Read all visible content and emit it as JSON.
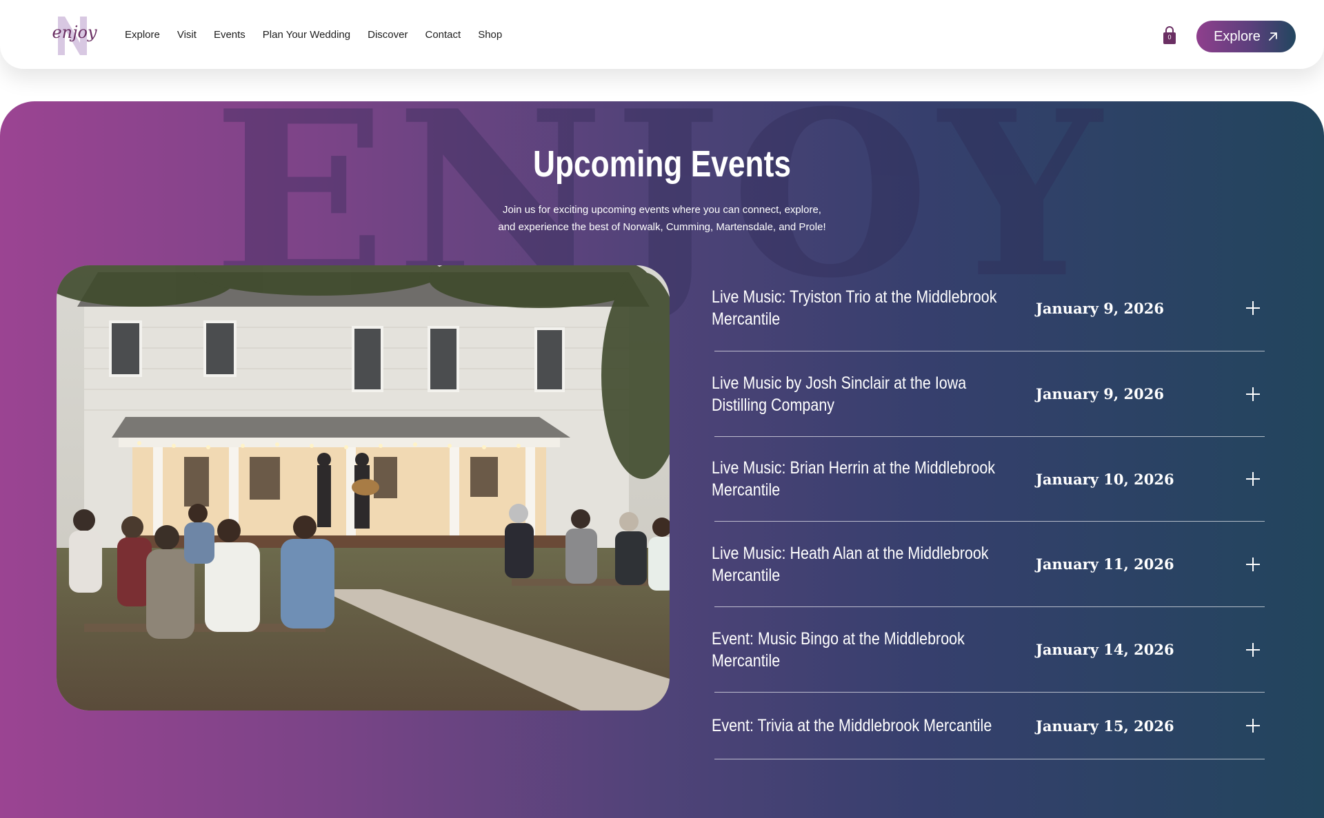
{
  "header": {
    "logo_text": "enjoy",
    "nav": [
      "Explore",
      "Visit",
      "Events",
      "Plan Your Wedding",
      "Discover",
      "Contact",
      "Shop"
    ],
    "cart_count": "0",
    "explore_button": "Explore"
  },
  "events_section": {
    "background_word": "ENJOY",
    "title": "Upcoming Events",
    "subtitle_line1": "Join us for exciting upcoming events where you can connect, explore,",
    "subtitle_line2": "and experience the best of Norwalk, Cumming, Martensdale, and Prole!",
    "events": [
      {
        "name": "Live Music: Tryiston Trio at the Middlebrook Mercantile",
        "date": "January 9, 2026"
      },
      {
        "name": "Live Music by Josh Sinclair at the Iowa Distilling Company",
        "date": "January 9, 2026"
      },
      {
        "name": "Live Music: Brian Herrin at the Middlebrook Mercantile",
        "date": "January 10, 2026"
      },
      {
        "name": "Live Music: Heath Alan at the Middlebrook Mercantile",
        "date": "January 11, 2026"
      },
      {
        "name": "Event: Music Bingo at the Middlebrook Mercantile",
        "date": "January 14, 2026"
      },
      {
        "name": "Event: Trivia at the Middlebrook Mercantile",
        "date": "January 15, 2026"
      }
    ]
  },
  "colors": {
    "gradient_start": "#9b4492",
    "gradient_end": "#22455d",
    "logo_purple": "#6a2f63",
    "logo_letter": "#d8c8e2"
  },
  "icons": {
    "cart": "shopping-bag-icon",
    "explore_arrow": "arrow-up-right-icon",
    "expand": "plus-icon"
  }
}
